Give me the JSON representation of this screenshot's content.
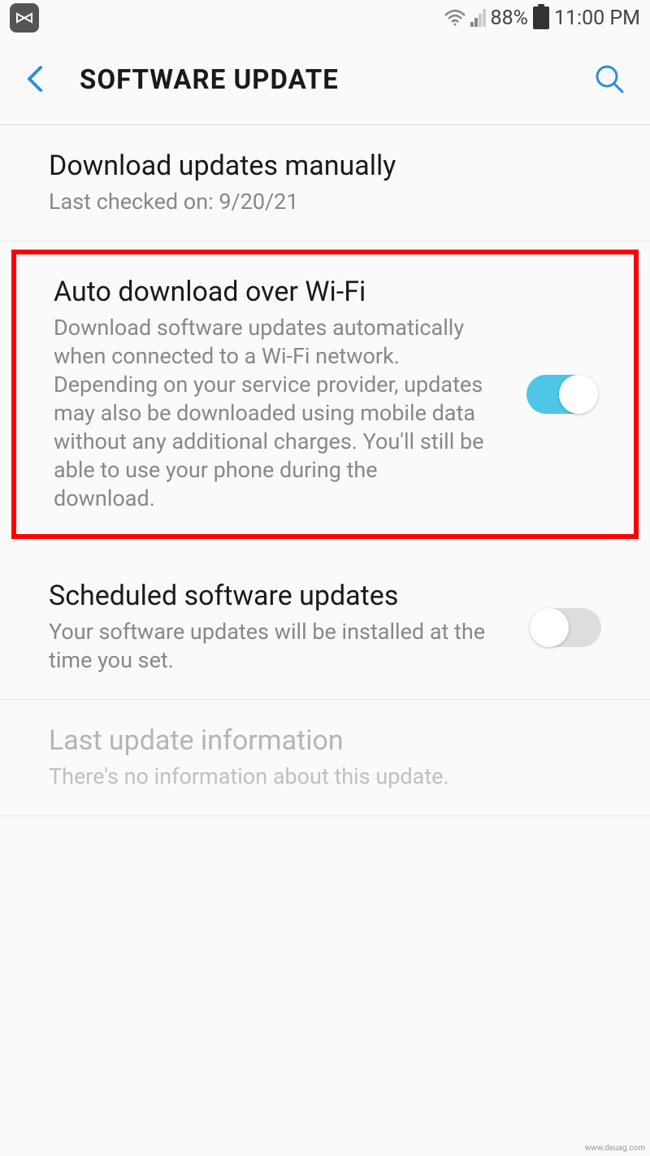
{
  "status_bar": {
    "battery_percent": "88%",
    "time": "11:00 PM"
  },
  "header": {
    "title": "SOFTWARE UPDATE"
  },
  "settings": {
    "manual": {
      "title": "Download updates manually",
      "subtitle": "Last checked on: 9/20/21"
    },
    "auto_wifi": {
      "title": "Auto download over Wi-Fi",
      "subtitle": "Download software updates automatically when connected to a Wi-Fi network. Depending on your service provider, updates may also be downloaded using mobile data without any additional charges. You'll still be able to use your phone during the download.",
      "toggle": true
    },
    "scheduled": {
      "title": "Scheduled software updates",
      "subtitle": "Your software updates will be installed at the time you set.",
      "toggle": false
    },
    "last_info": {
      "title": "Last update information",
      "subtitle": "There's no information about this update."
    }
  },
  "watermark": "www.deuag.com"
}
